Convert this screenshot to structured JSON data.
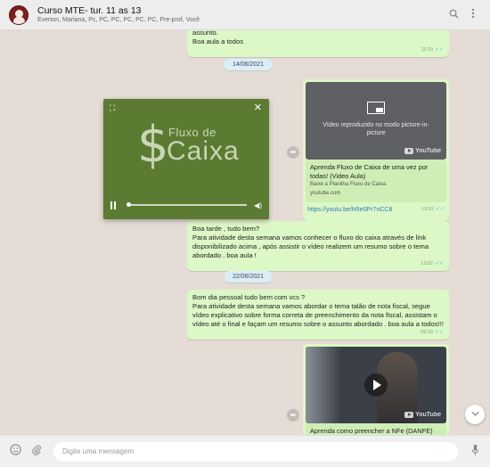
{
  "header": {
    "title": "Curso MTE- tur. 11 as 13",
    "members": "Everton, Mariana, Pc, PC, PC, PC, PC, PC, Pre-prof, Você",
    "search_icon": "search-icon",
    "menu_icon": "kebab-menu-icon"
  },
  "messages": {
    "top_text": "assunto.\nBoa aula a todos",
    "top_time": "11:29",
    "date1": "14/06/2021",
    "video1": {
      "pip_text": "Vídeo reproduzido no modo picture-in-picture",
      "yt_label": "YouTube",
      "title": "Aprenda Fluxo de Caixa de uma vez por todas! (Video Aula)",
      "desc": "Baixe a Planilha Fluxo de Caixa:",
      "domain": "youtube.com",
      "url": "https://youtu.be/hRe0Pr7nCC8",
      "time": "13:52"
    },
    "msg2_text": "Boa tarde , tudo bem?\nPara atividade desta semana vamos conhecer o fluxo do caixa através de link disponibilizado acima , após assistir o vídeo realizem um resumo sobre o tema abordado . boa aula !",
    "msg2_time": "13:52",
    "date2": "22/06/2021",
    "msg3_text": "Bom dia  pessoal tudo bem com vcs ?\nPara atividade desta semana vamos abordar o tema talão de nota fiscal, segue vídeo explicativo sobre forma correta de preenchimento da nota fiscal, assistam o vídeo até o final e façam um resumo sobre o assunto abordado . boa aula a todos!!!",
    "msg3_time": "09:18",
    "video2": {
      "yt_label": "YouTube",
      "title": "Aprenda como preencher a NFe (DANFE)"
    }
  },
  "pip_player": {
    "title_small": "Fluxo de",
    "title_big": "Caixa",
    "symbol": "$"
  },
  "composer": {
    "placeholder": "Digite uma mensagem"
  },
  "colors": {
    "outgoing_bubble": "#dcf8c6",
    "header_bg": "#ededed",
    "chat_bg": "#e5ddd5",
    "pip_bg": "#5b7b33",
    "read_ticks": "#4fc3f7"
  }
}
